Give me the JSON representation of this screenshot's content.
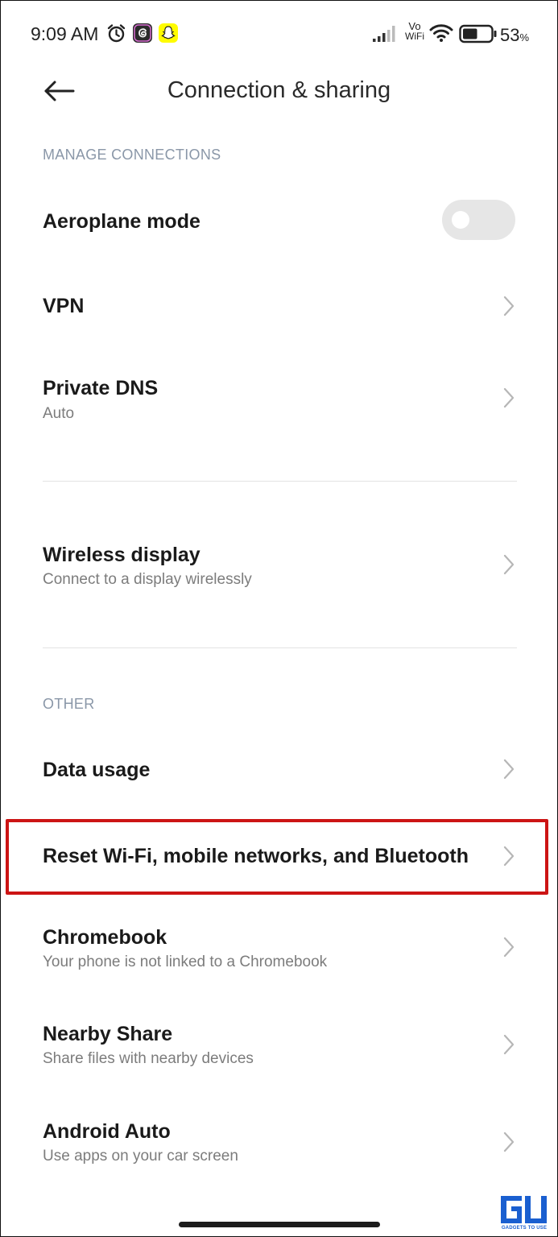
{
  "status_bar": {
    "time": "9:09 AM",
    "vowifi_top": "Vo",
    "vowifi_bottom": "WiFi",
    "battery_percent": "53",
    "battery_percent_sign": "%",
    "battery_level": 0.53,
    "icons": [
      "alarm-icon",
      "threads-app-icon",
      "snapchat-icon",
      "signal-icon",
      "vowifi-icon",
      "wifi-icon",
      "battery-icon"
    ]
  },
  "header": {
    "title": "Connection & sharing",
    "back_icon": "back-arrow-icon"
  },
  "sections": {
    "manage_connections": "MANAGE CONNECTIONS",
    "other": "OTHER"
  },
  "rows": {
    "aeroplane": {
      "title": "Aeroplane mode",
      "toggle_on": false
    },
    "vpn": {
      "title": "VPN"
    },
    "private_dns": {
      "title": "Private DNS",
      "subtitle": "Auto"
    },
    "wireless_display": {
      "title": "Wireless display",
      "subtitle": "Connect to a display wirelessly"
    },
    "data_usage": {
      "title": "Data usage"
    },
    "reset": {
      "title": "Reset Wi-Fi, mobile networks, and Bluetooth"
    },
    "chromebook": {
      "title": "Chromebook",
      "subtitle": "Your phone is not linked to a Chromebook"
    },
    "nearby_share": {
      "title": "Nearby Share",
      "subtitle": "Share files with nearby devices"
    },
    "android_auto": {
      "title": "Android Auto",
      "subtitle": "Use apps on your car screen"
    }
  },
  "colors": {
    "highlight": "#cc1414",
    "section_header": "#8a97a8",
    "watermark_blue": "#1a5fd0"
  },
  "watermark": {
    "logo_icon": "gadgets-to-use-logo",
    "text": "GADGETS TO USE"
  }
}
